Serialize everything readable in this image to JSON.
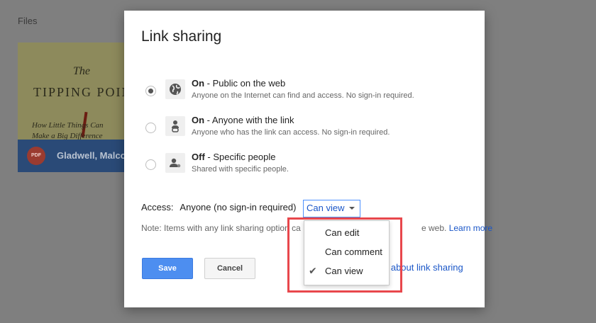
{
  "background": {
    "files_label": "Files",
    "card": {
      "cover_title_line1": "The",
      "cover_title_line2": "TIPPING POIN",
      "cover_subtitle_line1": "How Little Things Can",
      "cover_subtitle_line2": "Make a Big Difference",
      "file_badge": "PDF",
      "author": "Gladwell, Malcol"
    }
  },
  "dialog": {
    "title": "Link sharing",
    "options": [
      {
        "bold": "On",
        "rest": " - Public on the web",
        "desc": "Anyone on the Internet can find and access. No sign-in required.",
        "icon": "globe-icon",
        "selected": true
      },
      {
        "bold": "On",
        "rest": " - Anyone with the link",
        "desc": "Anyone who has the link can access. No sign-in required.",
        "icon": "link-person-icon",
        "selected": false
      },
      {
        "bold": "Off",
        "rest": " - Specific people",
        "desc": "Shared with specific people.",
        "icon": "person-icon",
        "selected": false
      }
    ],
    "access": {
      "label": "Access:",
      "value": "Anyone (no sign-in required)",
      "select_value": "Can view"
    },
    "note": {
      "text": "Note: Items with any link sharing option ca",
      "tail": "e web.",
      "link": "Learn more"
    },
    "buttons": {
      "save": "Save",
      "cancel": "Cancel"
    },
    "learn_about_link": "e about link sharing"
  },
  "dropdown": {
    "items": [
      {
        "label": "Can edit",
        "checked": false
      },
      {
        "label": "Can comment",
        "checked": false
      },
      {
        "label": "Can view",
        "checked": true
      }
    ],
    "check_glyph": "✔"
  },
  "colors": {
    "accent": "#4d8ef0",
    "link": "#1a56c8",
    "highlight": "#e8474c"
  }
}
